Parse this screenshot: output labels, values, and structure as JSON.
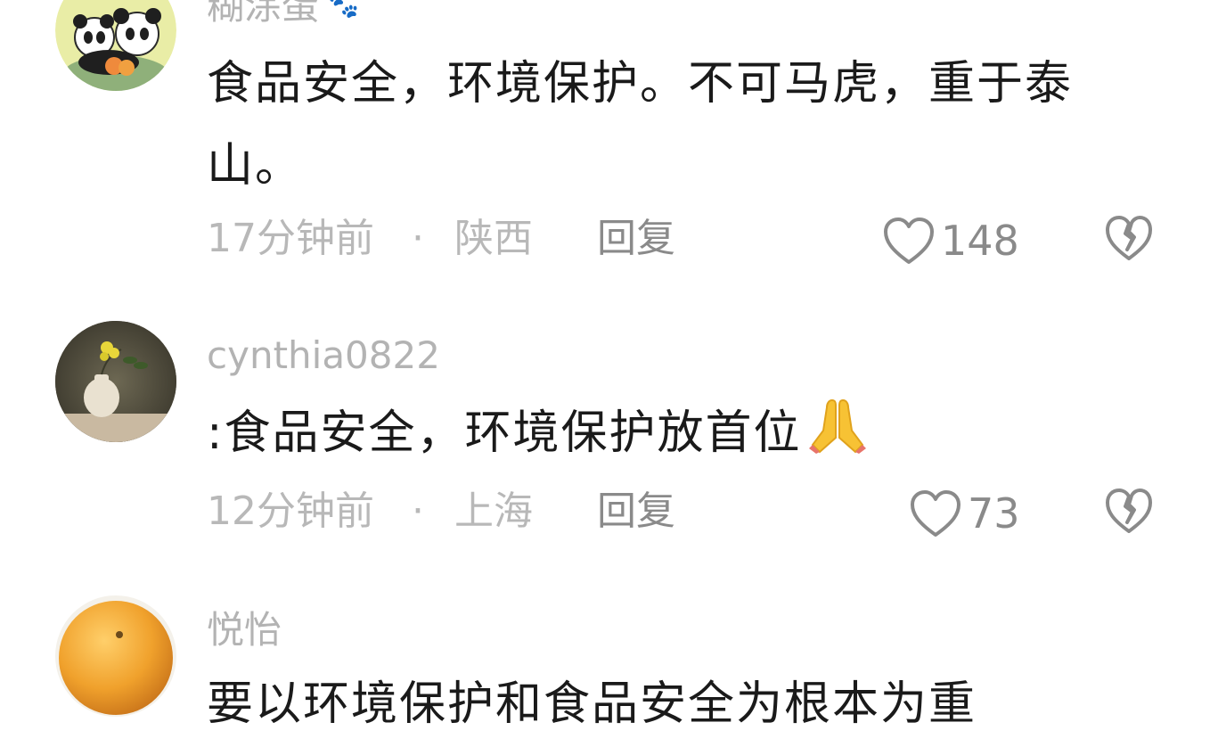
{
  "comments": [
    {
      "username": "糊涂蛋",
      "username_suffix_icon": "paw-icon",
      "content_line1": "食品安全，环境保护。不可马虎，重于泰",
      "content_line2": "山。",
      "time": "17分钟前",
      "dot": "·",
      "location": "陕西",
      "reply_label": "回复",
      "likes": "148",
      "like_icon": "heart-outline-icon",
      "dislike_icon": "broken-heart-icon",
      "avatar": "panda-avatar"
    },
    {
      "username": "cynthia0822",
      "content": ":食品安全，环境保护放首位",
      "content_emoji": "folded-hands-emoji",
      "time": "12分钟前",
      "dot": "·",
      "location": "上海",
      "reply_label": "回复",
      "likes": "73",
      "like_icon": "heart-outline-icon",
      "dislike_icon": "broken-heart-icon",
      "avatar": "flower-vase-avatar"
    },
    {
      "username": "悦怡",
      "content": "要以环境保护和食品安全为根本为重",
      "avatar": "orange-avatar"
    }
  ],
  "colors": {
    "text_primary": "#1a1a1a",
    "text_muted": "#b3b3b3",
    "icon_gray": "#8a8a8a"
  }
}
